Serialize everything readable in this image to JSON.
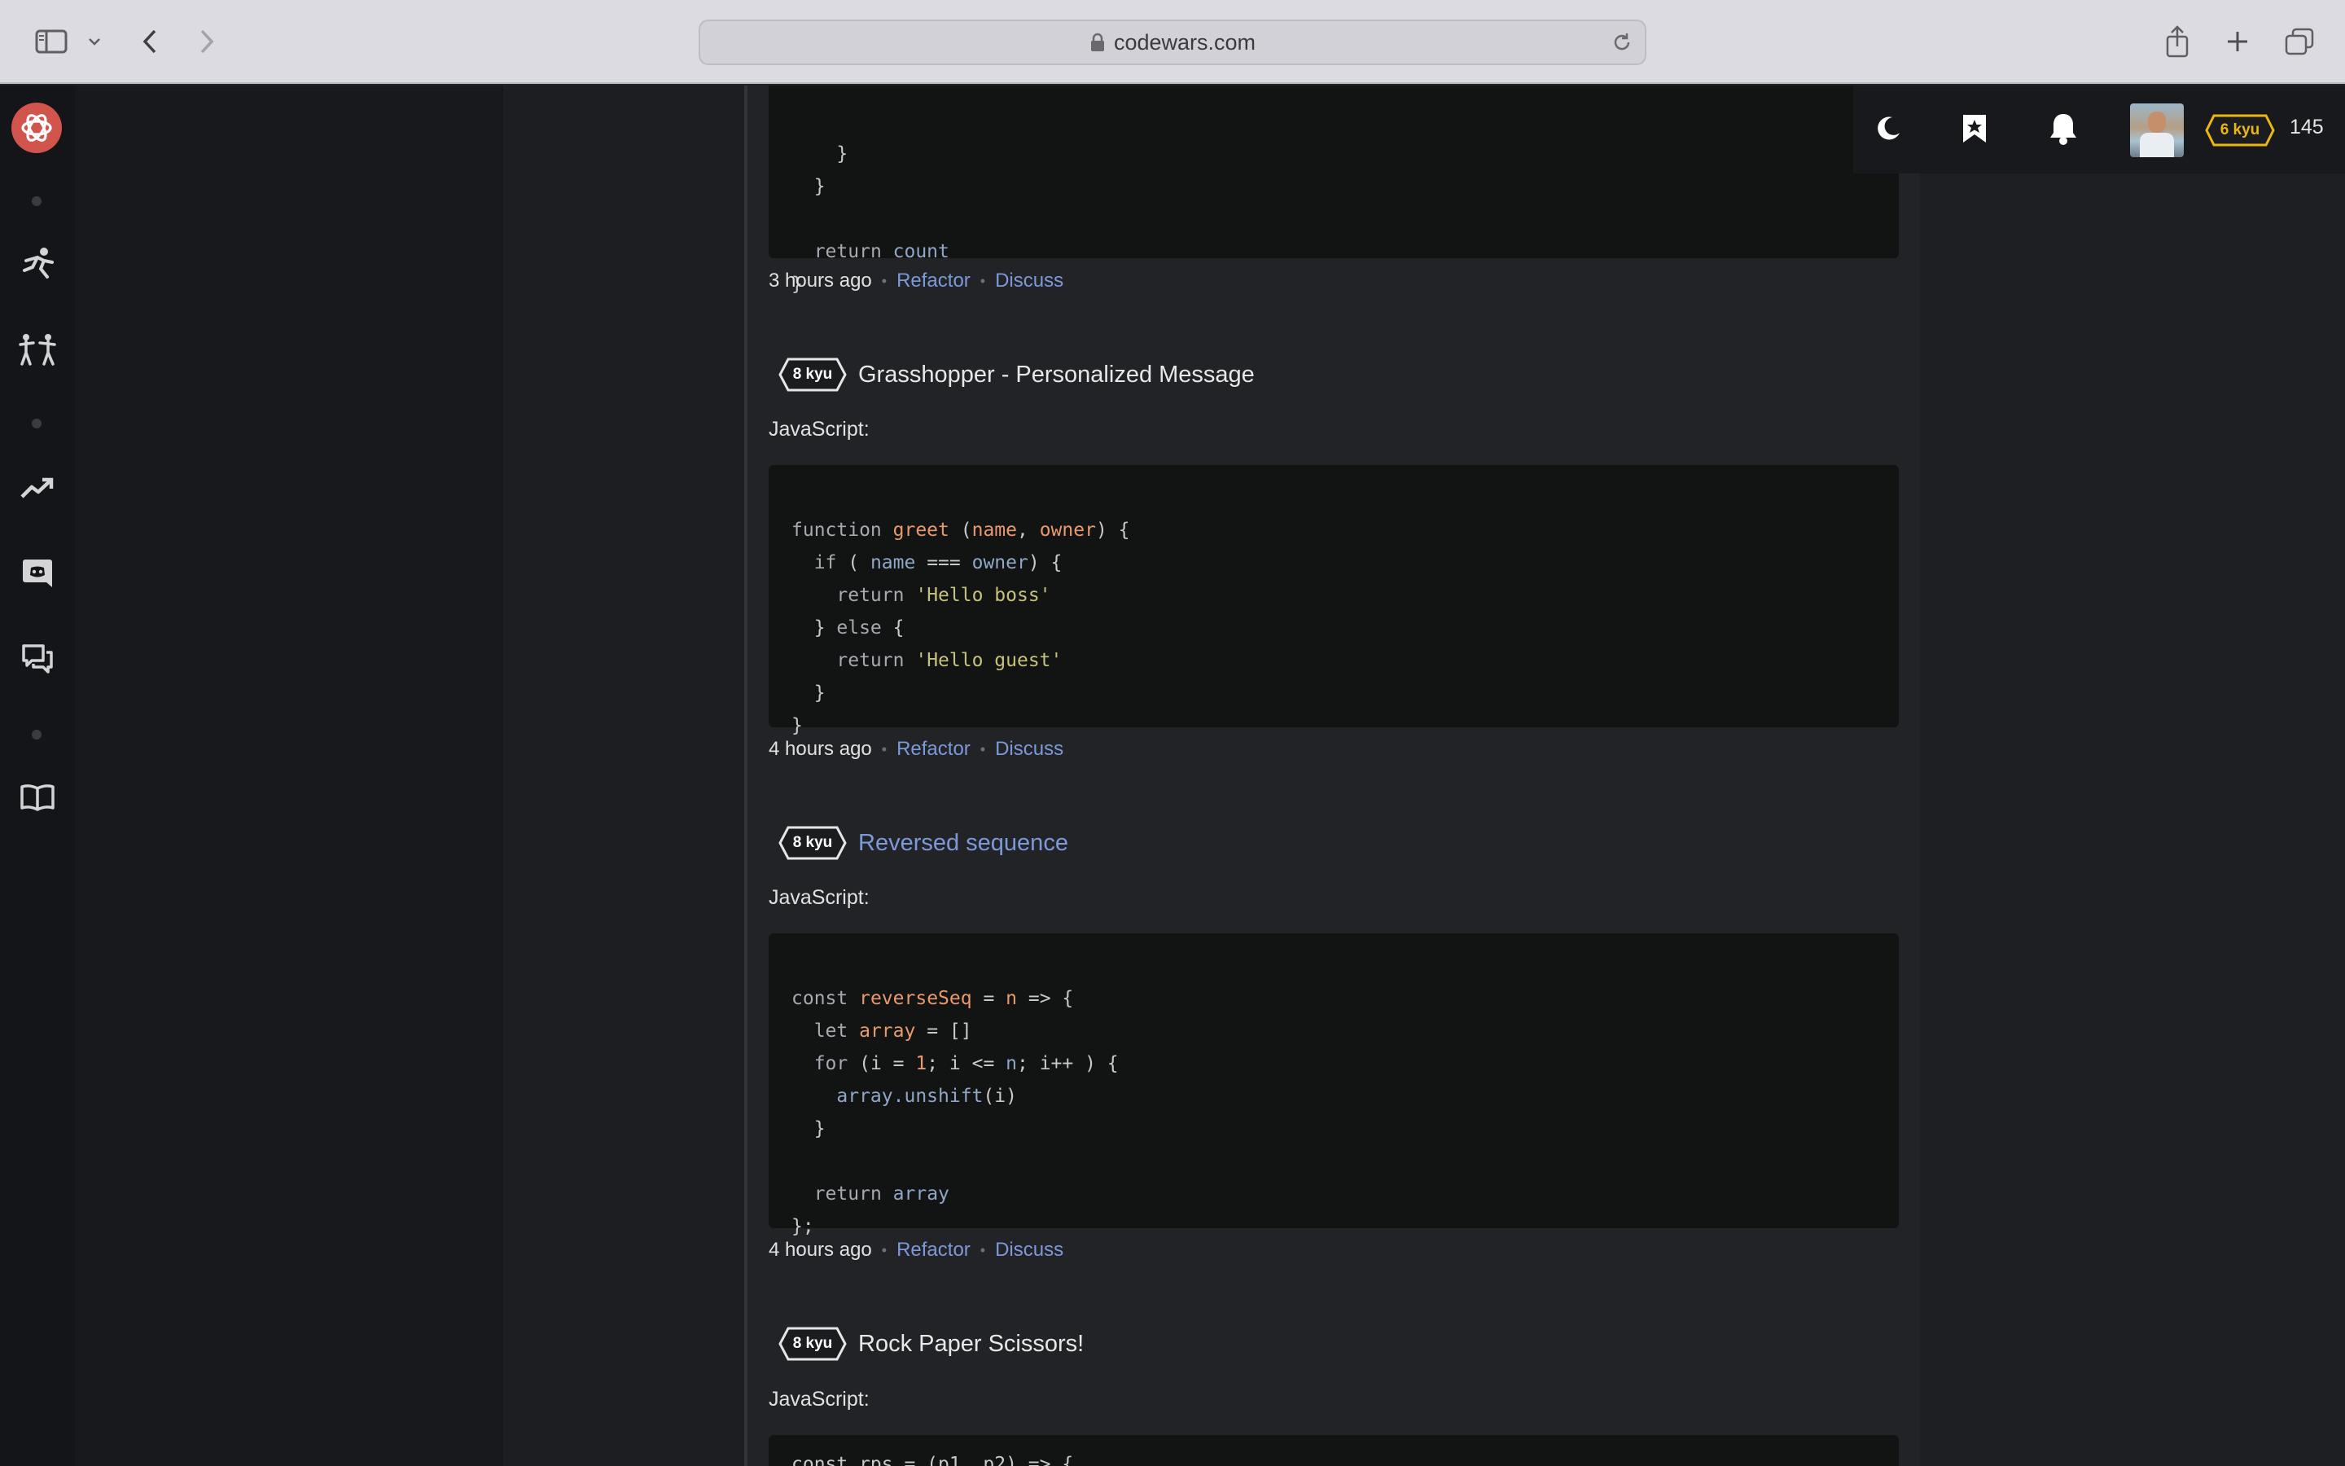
{
  "browser": {
    "url_host": "codewars.com"
  },
  "userbar": {
    "rank": "6 kyu",
    "honor": "145",
    "rank_color": "#ecb613"
  },
  "feed": {
    "top_code_tail": [
      "    }",
      "  }",
      "",
      "  return count",
      "}"
    ],
    "top_meta": {
      "time": "3 hours ago",
      "refactor": "Refactor",
      "discuss": "Discuss"
    },
    "katas": [
      {
        "kyu": "8 kyu",
        "title": "Grasshopper - Personalized Message",
        "language": "JavaScript:",
        "time": "4 hours ago",
        "refactor": "Refactor",
        "discuss": "Discuss"
      },
      {
        "kyu": "8 kyu",
        "title": "Reversed sequence",
        "language": "JavaScript:",
        "time": "4 hours ago",
        "refactor": "Refactor",
        "discuss": "Discuss"
      },
      {
        "kyu": "8 kyu",
        "title": "Rock Paper Scissors!",
        "language": "JavaScript:"
      }
    ],
    "code_greet": [
      "function greet (name, owner) {",
      "  if ( name === owner) {",
      "    return 'Hello boss'",
      "  } else {",
      "    return 'Hello guest'",
      "  }",
      "}"
    ],
    "code_reverse": [
      "const reverseSeq = n => {",
      "  let array = []",
      "  for (i = 1; i <= n; i++ ) {",
      "    array.unshift(i)",
      "  }",
      "",
      "  return array",
      "};"
    ],
    "code_rps_partial": "const rps = (p1, p2) => {"
  },
  "colors": {
    "accent_link": "#7c99d8",
    "brand_red": "#d2554d",
    "code_bg": "#121313"
  }
}
